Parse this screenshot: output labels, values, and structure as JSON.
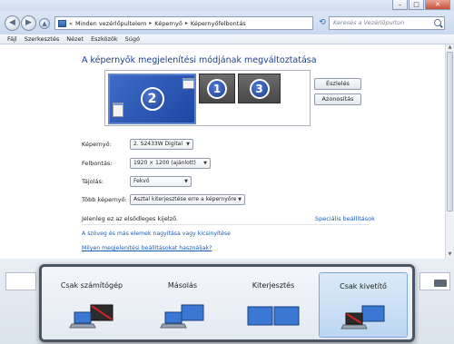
{
  "window": {
    "buttons": [
      "–",
      "□",
      "✕"
    ]
  },
  "address": {
    "overflow": "«",
    "crumbs": [
      "Minden vezérlőpultelem",
      "Képernyő",
      "Képernyőfelbontás"
    ],
    "separator": "▸",
    "search_placeholder": "Keresés a Vezérlőpulton"
  },
  "menu": {
    "items": [
      "Fájl",
      "Szerkesztés",
      "Nézet",
      "Eszközök",
      "Súgó"
    ]
  },
  "main": {
    "heading": "A képernyők megjelenítési módjának megváltoztatása",
    "monitors": [
      "2",
      "1",
      "3"
    ],
    "detect_button": "Észlelés",
    "identify_button": "Azonosítás",
    "form": {
      "display_label": "Képernyő:",
      "display_value": "2. S2433W Digital",
      "resolution_label": "Felbontás:",
      "resolution_value": "1920 × 1200 (ajánlott)",
      "orientation_label": "Tájolás:",
      "orientation_value": "Fekvő",
      "multi_label": "Több képernyő:",
      "multi_value": "Asztal kiterjesztése erre a képernyőre"
    },
    "primary_text": "Jelenleg ez az elsődleges kijelző.",
    "advanced_link": "Speciális beállítások",
    "link_text_size": "A szöveg és más elemek nagyítása vagy kicsinyítése",
    "link_settings": "Milyen megjelenítési beállításokat használjak?"
  },
  "switcher": {
    "options": [
      "Csak számítógép",
      "Másolás",
      "Kiterjesztés",
      "Csak kivetítő"
    ],
    "selected": "Csak kivetítő"
  },
  "colors": {
    "accent": "#1e3f8c",
    "link": "#1a5ab4",
    "selected_monitor": "#2f5bbd",
    "selected_option": "#cfe2f6"
  }
}
